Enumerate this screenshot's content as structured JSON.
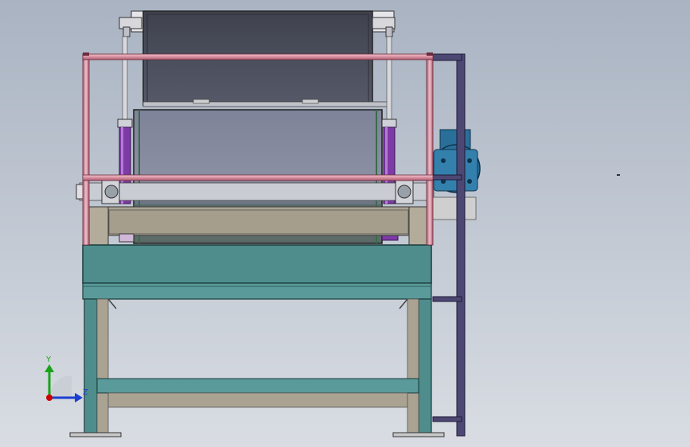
{
  "viewport": {
    "background_top": "#a9b3c2",
    "background_bottom": "#d9dde3"
  },
  "triad": {
    "y_label": "Y",
    "z_label": "Z",
    "x_color": "#cc0000",
    "y_color": "#19a319",
    "z_color": "#1a3fd1"
  },
  "colors": {
    "frame_teal": "#4f8d8d",
    "frame_teal_dark": "#2f5f5f",
    "beige_frame": "#aaa392",
    "drum_gray": "#8a8fa5",
    "hood_dark": "#4a4d5a",
    "rail_pink": "#d98ea0",
    "ladder_purple": "#4d4873",
    "cylinder_purple": "#7e3aa6",
    "motor_blue": "#2a6f9a"
  }
}
